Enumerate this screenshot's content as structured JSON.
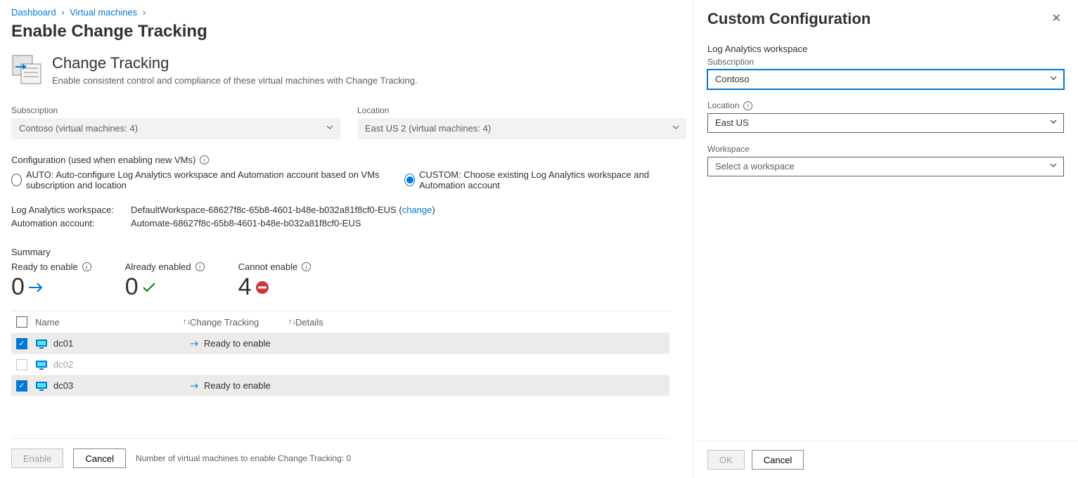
{
  "breadcrumb": {
    "dashboard": "Dashboard",
    "vms": "Virtual machines"
  },
  "page_title": "Enable Change Tracking",
  "feature": {
    "title": "Change Tracking",
    "desc": "Enable consistent control and compliance of these virtual machines with Change Tracking."
  },
  "filters": {
    "subscription_label": "Subscription",
    "subscription_value": "Contoso (virtual machines: 4)",
    "location_label": "Location",
    "location_value": "East US 2 (virtual machines: 4)"
  },
  "config": {
    "label": "Configuration (used when enabling new VMs)",
    "auto": "AUTO: Auto-configure Log Analytics workspace and Automation account based on VMs subscription and location",
    "custom": "CUSTOM: Choose existing Log Analytics workspace and Automation account"
  },
  "details": {
    "workspace_label": "Log Analytics workspace:",
    "workspace_value": "DefaultWorkspace-68627f8c-65b8-4601-b48e-b032a81f8cf0-EUS",
    "change_link": "change",
    "automation_label": "Automation account:",
    "automation_value": "Automate-68627f8c-65b8-4601-b48e-b032a81f8cf0-EUS"
  },
  "summary": {
    "title": "Summary",
    "ready_label": "Ready to enable",
    "ready_value": "0",
    "already_label": "Already enabled",
    "already_value": "0",
    "cannot_label": "Cannot enable",
    "cannot_value": "4"
  },
  "table": {
    "col_name": "Name",
    "col_ct": "Change Tracking",
    "col_details": "Details",
    "rows": [
      {
        "name": "dc01",
        "status": "Ready to enable",
        "checked": true
      },
      {
        "name": "dc02",
        "status": "",
        "checked": false
      },
      {
        "name": "dc03",
        "status": "Ready to enable",
        "checked": true
      }
    ]
  },
  "footer": {
    "enable": "Enable",
    "cancel": "Cancel",
    "text": "Number of virtual machines to enable Change Tracking: 0"
  },
  "panel": {
    "title": "Custom Configuration",
    "section_label": "Log Analytics workspace",
    "subscription_label": "Subscription",
    "subscription_value": "Contoso",
    "location_label": "Location",
    "location_value": "East US",
    "workspace_label": "Workspace",
    "workspace_placeholder": "Select a workspace",
    "ok": "OK",
    "cancel": "Cancel"
  }
}
